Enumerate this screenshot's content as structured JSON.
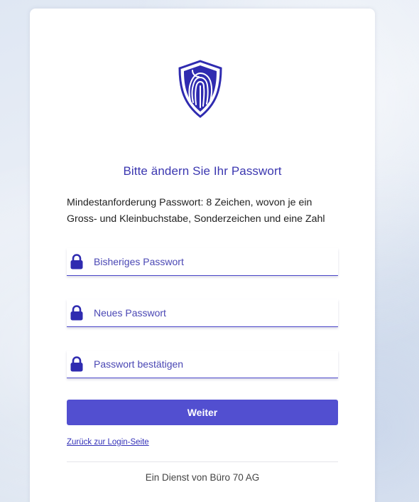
{
  "title": "Bitte ändern Sie Ihr Passwort",
  "requirements": "Mindestanforderung Passwort: 8 Zeichen, wovon je ein Gross- und Kleinbuchstabe, Sonderzeichen und eine Zahl",
  "fields": [
    {
      "placeholder": "Bisheriges Passwort",
      "value": ""
    },
    {
      "placeholder": "Neues Passwort",
      "value": ""
    },
    {
      "placeholder": "Passwort bestätigen",
      "value": ""
    }
  ],
  "submit_label": "Weiter",
  "back_link": "Zurück zur Login-Seite",
  "footer": "Ein Dienst von Büro 70 AG",
  "icons": {
    "logo": "shield-fingerprint-icon",
    "field": "lock-icon"
  },
  "colors": {
    "accent": "#524fd0",
    "title": "#3b37b0",
    "logo": "#2f2bb0"
  }
}
